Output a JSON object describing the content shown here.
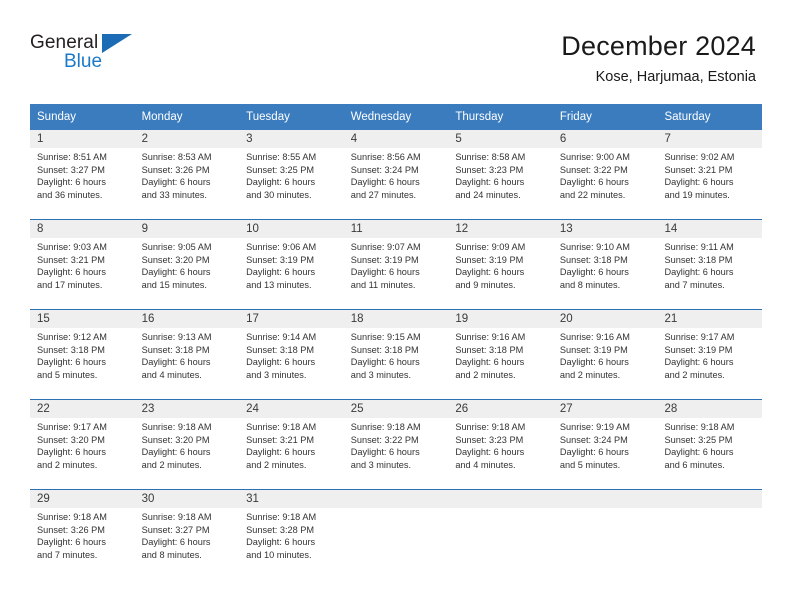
{
  "brand": {
    "name_top": "General",
    "name_bottom": "Blue",
    "accent_color": "#1b79c8",
    "triangle_color": "#1b6bb5"
  },
  "header": {
    "title": "December 2024",
    "subtitle": "Kose, Harjumaa, Estonia"
  },
  "theme": {
    "header_row_bg": "#3a7cbe",
    "week_separator": "#2c6fb3",
    "day_band_bg": "#efefef",
    "text_color": "#333333"
  },
  "weekdays": [
    "Sunday",
    "Monday",
    "Tuesday",
    "Wednesday",
    "Thursday",
    "Friday",
    "Saturday"
  ],
  "weeks": [
    [
      {
        "day": "1",
        "sunrise": "Sunrise: 8:51 AM",
        "sunset": "Sunset: 3:27 PM",
        "daylight1": "Daylight: 6 hours",
        "daylight2": "and 36 minutes."
      },
      {
        "day": "2",
        "sunrise": "Sunrise: 8:53 AM",
        "sunset": "Sunset: 3:26 PM",
        "daylight1": "Daylight: 6 hours",
        "daylight2": "and 33 minutes."
      },
      {
        "day": "3",
        "sunrise": "Sunrise: 8:55 AM",
        "sunset": "Sunset: 3:25 PM",
        "daylight1": "Daylight: 6 hours",
        "daylight2": "and 30 minutes."
      },
      {
        "day": "4",
        "sunrise": "Sunrise: 8:56 AM",
        "sunset": "Sunset: 3:24 PM",
        "daylight1": "Daylight: 6 hours",
        "daylight2": "and 27 minutes."
      },
      {
        "day": "5",
        "sunrise": "Sunrise: 8:58 AM",
        "sunset": "Sunset: 3:23 PM",
        "daylight1": "Daylight: 6 hours",
        "daylight2": "and 24 minutes."
      },
      {
        "day": "6",
        "sunrise": "Sunrise: 9:00 AM",
        "sunset": "Sunset: 3:22 PM",
        "daylight1": "Daylight: 6 hours",
        "daylight2": "and 22 minutes."
      },
      {
        "day": "7",
        "sunrise": "Sunrise: 9:02 AM",
        "sunset": "Sunset: 3:21 PM",
        "daylight1": "Daylight: 6 hours",
        "daylight2": "and 19 minutes."
      }
    ],
    [
      {
        "day": "8",
        "sunrise": "Sunrise: 9:03 AM",
        "sunset": "Sunset: 3:21 PM",
        "daylight1": "Daylight: 6 hours",
        "daylight2": "and 17 minutes."
      },
      {
        "day": "9",
        "sunrise": "Sunrise: 9:05 AM",
        "sunset": "Sunset: 3:20 PM",
        "daylight1": "Daylight: 6 hours",
        "daylight2": "and 15 minutes."
      },
      {
        "day": "10",
        "sunrise": "Sunrise: 9:06 AM",
        "sunset": "Sunset: 3:19 PM",
        "daylight1": "Daylight: 6 hours",
        "daylight2": "and 13 minutes."
      },
      {
        "day": "11",
        "sunrise": "Sunrise: 9:07 AM",
        "sunset": "Sunset: 3:19 PM",
        "daylight1": "Daylight: 6 hours",
        "daylight2": "and 11 minutes."
      },
      {
        "day": "12",
        "sunrise": "Sunrise: 9:09 AM",
        "sunset": "Sunset: 3:19 PM",
        "daylight1": "Daylight: 6 hours",
        "daylight2": "and 9 minutes."
      },
      {
        "day": "13",
        "sunrise": "Sunrise: 9:10 AM",
        "sunset": "Sunset: 3:18 PM",
        "daylight1": "Daylight: 6 hours",
        "daylight2": "and 8 minutes."
      },
      {
        "day": "14",
        "sunrise": "Sunrise: 9:11 AM",
        "sunset": "Sunset: 3:18 PM",
        "daylight1": "Daylight: 6 hours",
        "daylight2": "and 7 minutes."
      }
    ],
    [
      {
        "day": "15",
        "sunrise": "Sunrise: 9:12 AM",
        "sunset": "Sunset: 3:18 PM",
        "daylight1": "Daylight: 6 hours",
        "daylight2": "and 5 minutes."
      },
      {
        "day": "16",
        "sunrise": "Sunrise: 9:13 AM",
        "sunset": "Sunset: 3:18 PM",
        "daylight1": "Daylight: 6 hours",
        "daylight2": "and 4 minutes."
      },
      {
        "day": "17",
        "sunrise": "Sunrise: 9:14 AM",
        "sunset": "Sunset: 3:18 PM",
        "daylight1": "Daylight: 6 hours",
        "daylight2": "and 3 minutes."
      },
      {
        "day": "18",
        "sunrise": "Sunrise: 9:15 AM",
        "sunset": "Sunset: 3:18 PM",
        "daylight1": "Daylight: 6 hours",
        "daylight2": "and 3 minutes."
      },
      {
        "day": "19",
        "sunrise": "Sunrise: 9:16 AM",
        "sunset": "Sunset: 3:18 PM",
        "daylight1": "Daylight: 6 hours",
        "daylight2": "and 2 minutes."
      },
      {
        "day": "20",
        "sunrise": "Sunrise: 9:16 AM",
        "sunset": "Sunset: 3:19 PM",
        "daylight1": "Daylight: 6 hours",
        "daylight2": "and 2 minutes."
      },
      {
        "day": "21",
        "sunrise": "Sunrise: 9:17 AM",
        "sunset": "Sunset: 3:19 PM",
        "daylight1": "Daylight: 6 hours",
        "daylight2": "and 2 minutes."
      }
    ],
    [
      {
        "day": "22",
        "sunrise": "Sunrise: 9:17 AM",
        "sunset": "Sunset: 3:20 PM",
        "daylight1": "Daylight: 6 hours",
        "daylight2": "and 2 minutes."
      },
      {
        "day": "23",
        "sunrise": "Sunrise: 9:18 AM",
        "sunset": "Sunset: 3:20 PM",
        "daylight1": "Daylight: 6 hours",
        "daylight2": "and 2 minutes."
      },
      {
        "day": "24",
        "sunrise": "Sunrise: 9:18 AM",
        "sunset": "Sunset: 3:21 PM",
        "daylight1": "Daylight: 6 hours",
        "daylight2": "and 2 minutes."
      },
      {
        "day": "25",
        "sunrise": "Sunrise: 9:18 AM",
        "sunset": "Sunset: 3:22 PM",
        "daylight1": "Daylight: 6 hours",
        "daylight2": "and 3 minutes."
      },
      {
        "day": "26",
        "sunrise": "Sunrise: 9:18 AM",
        "sunset": "Sunset: 3:23 PM",
        "daylight1": "Daylight: 6 hours",
        "daylight2": "and 4 minutes."
      },
      {
        "day": "27",
        "sunrise": "Sunrise: 9:19 AM",
        "sunset": "Sunset: 3:24 PM",
        "daylight1": "Daylight: 6 hours",
        "daylight2": "and 5 minutes."
      },
      {
        "day": "28",
        "sunrise": "Sunrise: 9:18 AM",
        "sunset": "Sunset: 3:25 PM",
        "daylight1": "Daylight: 6 hours",
        "daylight2": "and 6 minutes."
      }
    ],
    [
      {
        "day": "29",
        "sunrise": "Sunrise: 9:18 AM",
        "sunset": "Sunset: 3:26 PM",
        "daylight1": "Daylight: 6 hours",
        "daylight2": "and 7 minutes."
      },
      {
        "day": "30",
        "sunrise": "Sunrise: 9:18 AM",
        "sunset": "Sunset: 3:27 PM",
        "daylight1": "Daylight: 6 hours",
        "daylight2": "and 8 minutes."
      },
      {
        "day": "31",
        "sunrise": "Sunrise: 9:18 AM",
        "sunset": "Sunset: 3:28 PM",
        "daylight1": "Daylight: 6 hours",
        "daylight2": "and 10 minutes."
      },
      {
        "day": "",
        "sunrise": "",
        "sunset": "",
        "daylight1": "",
        "daylight2": ""
      },
      {
        "day": "",
        "sunrise": "",
        "sunset": "",
        "daylight1": "",
        "daylight2": ""
      },
      {
        "day": "",
        "sunrise": "",
        "sunset": "",
        "daylight1": "",
        "daylight2": ""
      },
      {
        "day": "",
        "sunrise": "",
        "sunset": "",
        "daylight1": "",
        "daylight2": ""
      }
    ]
  ]
}
